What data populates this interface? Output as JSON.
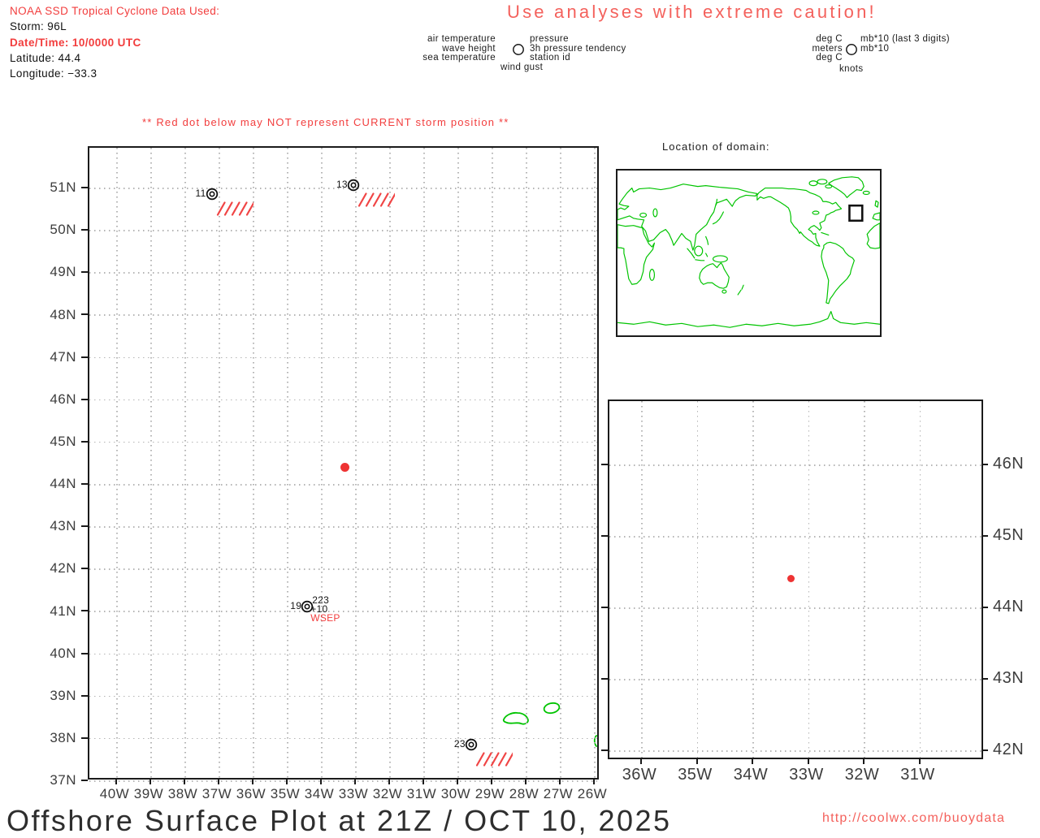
{
  "colors": {
    "red_text": "#f23d3d",
    "soft_red": "#f4615c",
    "coast_green": "#00c400",
    "storm_red": "#ee3333",
    "grid_gray": "#b4b4b4",
    "axis_text": "#3d3d3d"
  },
  "header": {
    "title_line": "NOAA SSD Tropical Cyclone Data Used:",
    "storm": "Storm: 96L",
    "datetime": "Date/Time: 10/0000 UTC",
    "latitude": "Latitude: 44.4",
    "longitude": "Longitude: −33.3"
  },
  "caution": "Use analyses with extreme caution!",
  "legend_plot": {
    "row1_left": "air temperature",
    "row1_right": "pressure",
    "row2_left": "wave height",
    "row2_right": "3h pressure tendency",
    "row3_left": "sea temperature",
    "row3_right": "station id",
    "row4": "wind gust"
  },
  "legend_units": {
    "row1_left": "deg C",
    "row1_right": "mb*10 (last 3 digits)",
    "row2_left": "meters",
    "row2_right": "mb*10",
    "row3_left": "deg C",
    "row4": "knots"
  },
  "warning": "** Red dot below may NOT represent CURRENT storm position **",
  "domain_inset": {
    "title": "Location of domain:"
  },
  "footer": {
    "title": "Offshore Surface Plot at 21Z / OCT 10, 2025",
    "url": "http://coolwx.com/buoydata"
  },
  "chart_data": [
    {
      "type": "scatter",
      "name": "main-offshore-map",
      "title": "Offshore surface station plot, North Atlantic",
      "x_tick_labels": [
        "40W",
        "39W",
        "38W",
        "37W",
        "36W",
        "35W",
        "34W",
        "33W",
        "32W",
        "31W",
        "30W",
        "29W",
        "28W",
        "27W",
        "26W"
      ],
      "y_tick_labels": [
        "51N",
        "50N",
        "49N",
        "48N",
        "47N",
        "46N",
        "45N",
        "44N",
        "43N",
        "42N",
        "41N",
        "40N",
        "39N",
        "38N",
        "37N"
      ],
      "xlim_deg_west": [
        40,
        26
      ],
      "ylim_deg_north": [
        37,
        51
      ],
      "grid": "dotted, 1 degree spacing",
      "storm_point": {
        "lon_w": 33.3,
        "lat_n": 44.4
      },
      "stations": [
        {
          "id_left": "11",
          "lon_w": 37.2,
          "lat_n": 50.85,
          "missing": true
        },
        {
          "id_left": "13",
          "lon_w": 33.05,
          "lat_n": 51.05,
          "missing": true
        },
        {
          "id_left": "19",
          "lon_w": 34.4,
          "lat_n": 41.1,
          "missing": false,
          "pressure": "223",
          "tendency": "+10",
          "station_id": "WSEP"
        },
        {
          "id_left": "23",
          "lon_w": 29.6,
          "lat_n": 37.85,
          "missing": true
        }
      ]
    },
    {
      "type": "scatter",
      "name": "domain-zoom-map",
      "title": "Zoomed storm domain",
      "x_tick_labels": [
        "36W",
        "35W",
        "34W",
        "33W",
        "32W",
        "31W"
      ],
      "y_tick_labels": [
        "46N",
        "45N",
        "44N",
        "43N",
        "42N"
      ],
      "xlim_deg_west": [
        36,
        31
      ],
      "ylim_deg_north": [
        42,
        46
      ],
      "grid": "dotted, 1 degree spacing",
      "storm_point": {
        "lon_w": 33.3,
        "lat_n": 44.4
      }
    }
  ]
}
